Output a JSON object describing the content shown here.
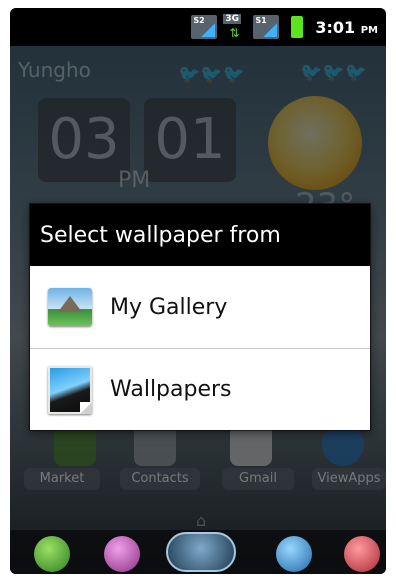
{
  "status_bar": {
    "signal_1_label": "S2",
    "network_label": "3G",
    "signal_2_label": "S1",
    "time": "3:01",
    "ampm": "PM",
    "colors": {
      "battery": "#5de21f",
      "signal": "#3fb2ff"
    }
  },
  "home": {
    "location": "Yungho",
    "clock_hour": "03",
    "clock_minute": "01",
    "clock_ampm": "PM",
    "temperature": "23°",
    "apps": [
      {
        "label": "Market"
      },
      {
        "label": "Contacts"
      },
      {
        "label": "Gmail"
      },
      {
        "label": "ViewApps"
      }
    ]
  },
  "dialog": {
    "title": "Select wallpaper from",
    "options": [
      {
        "label": "My Gallery",
        "icon": "gallery-icon"
      },
      {
        "label": "Wallpapers",
        "icon": "wallpapers-icon"
      }
    ]
  },
  "dock": {
    "items": [
      "phone-icon",
      "messaging-icon",
      "center-launcher-icon",
      "browser-icon",
      "apps-grid-icon"
    ]
  }
}
